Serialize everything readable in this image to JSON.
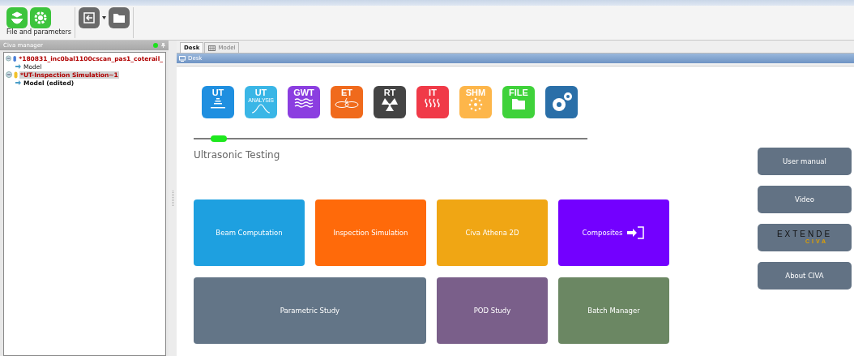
{
  "toolbar": {
    "caption": "File and parameters"
  },
  "manager": {
    "title": "Civa manager",
    "tree": [
      {
        "label": "*180831_inc0bal1100cscan_pas1_coterail_",
        "kind": "study",
        "selected": false,
        "children": [
          {
            "label": "Model",
            "edited": false
          }
        ]
      },
      {
        "label": "*UT-Inspection Simulation~1",
        "kind": "simulation",
        "selected": true,
        "children": [
          {
            "label": "Model (edited)",
            "edited": true
          }
        ]
      }
    ]
  },
  "tabs": [
    {
      "label": "Desk",
      "selected": true
    },
    {
      "label": "Model",
      "selected": false
    }
  ],
  "desk": {
    "title": "Desk",
    "modules": [
      {
        "label": "UT",
        "kind": "ut",
        "color": "#1f8fe0",
        "selected": true
      },
      {
        "label": "UT",
        "sub": "ANALYSIS",
        "kind": "analysis",
        "color": "#3ab6e6",
        "selected": false
      },
      {
        "label": "GWT",
        "kind": "waves",
        "color": "#8b3ee0",
        "selected": false
      },
      {
        "label": "ET",
        "kind": "coil",
        "color": "#f06a1c",
        "selected": false
      },
      {
        "label": "RT",
        "kind": "radiation",
        "color": "#444444",
        "selected": false
      },
      {
        "label": "IT",
        "kind": "heat",
        "color": "#f03a48",
        "selected": false
      },
      {
        "label": "SHM",
        "kind": "sensor",
        "color": "#fdb64a",
        "selected": false
      },
      {
        "label": "FILE",
        "kind": "folder",
        "color": "#3fd23a",
        "selected": false
      },
      {
        "kind": "gears",
        "color": "#2a6fa8",
        "selected": false
      }
    ],
    "section": "Ultrasonic Testing",
    "tiles": [
      {
        "label": "Beam Computation",
        "color": "#1ea0e0",
        "wide": false
      },
      {
        "label": "Inspection Simulation",
        "color": "#ff6a0a",
        "wide": false
      },
      {
        "label": "Civa Athena 2D",
        "color": "#f0a614",
        "wide": false
      },
      {
        "label": "Composites",
        "color": "#7300ff",
        "wide": false,
        "icon": true
      },
      {
        "label": "Parametric Study",
        "color": "#637587",
        "wide": true
      },
      {
        "label": "POD Study",
        "color": "#7a5f8a",
        "wide": false
      },
      {
        "label": "Batch Manager",
        "color": "#6b8763",
        "wide": false
      }
    ],
    "links": [
      {
        "label": "User manual",
        "kind": "text"
      },
      {
        "label": "Video",
        "kind": "text"
      },
      {
        "label": "EXTENDE",
        "sub": "CIVA",
        "kind": "logo"
      },
      {
        "label": "About CIVA",
        "kind": "text"
      }
    ]
  }
}
